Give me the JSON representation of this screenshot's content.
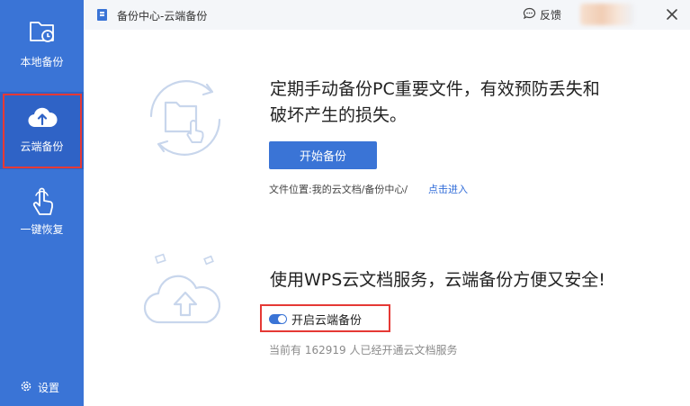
{
  "window": {
    "title": "备份中心-云端备份",
    "feedback_label": "反馈"
  },
  "sidebar": {
    "items": [
      {
        "id": "local",
        "label": "本地备份",
        "icon": "folder-clock-icon"
      },
      {
        "id": "cloud",
        "label": "云端备份",
        "icon": "cloud-upload-icon",
        "active": true
      },
      {
        "id": "restore",
        "label": "一键恢复",
        "icon": "hand-pointer-icon"
      }
    ],
    "settings_label": "设置"
  },
  "main": {
    "section1": {
      "line1": "定期手动备份PC重要文件，有效预防丢失和",
      "line2": "破坏产生的损失。",
      "button_label": "开始备份",
      "location_text": "文件位置:我的云文档/备份中心/",
      "location_link": "点击进入"
    },
    "section2": {
      "headline": "使用WPS云文档服务，云端备份方便又安全!",
      "toggle_label": "开启云端备份",
      "toggle_on": true,
      "users_note": "当前有 162919 人已经开通云文档服务"
    }
  },
  "colors": {
    "sidebar": "#3a74d6",
    "sidebar_active": "#2f63c6",
    "primary": "#3a74d6",
    "link": "#2f6bd8",
    "highlight": "#e53935",
    "illustration": "#c8d6ec"
  }
}
